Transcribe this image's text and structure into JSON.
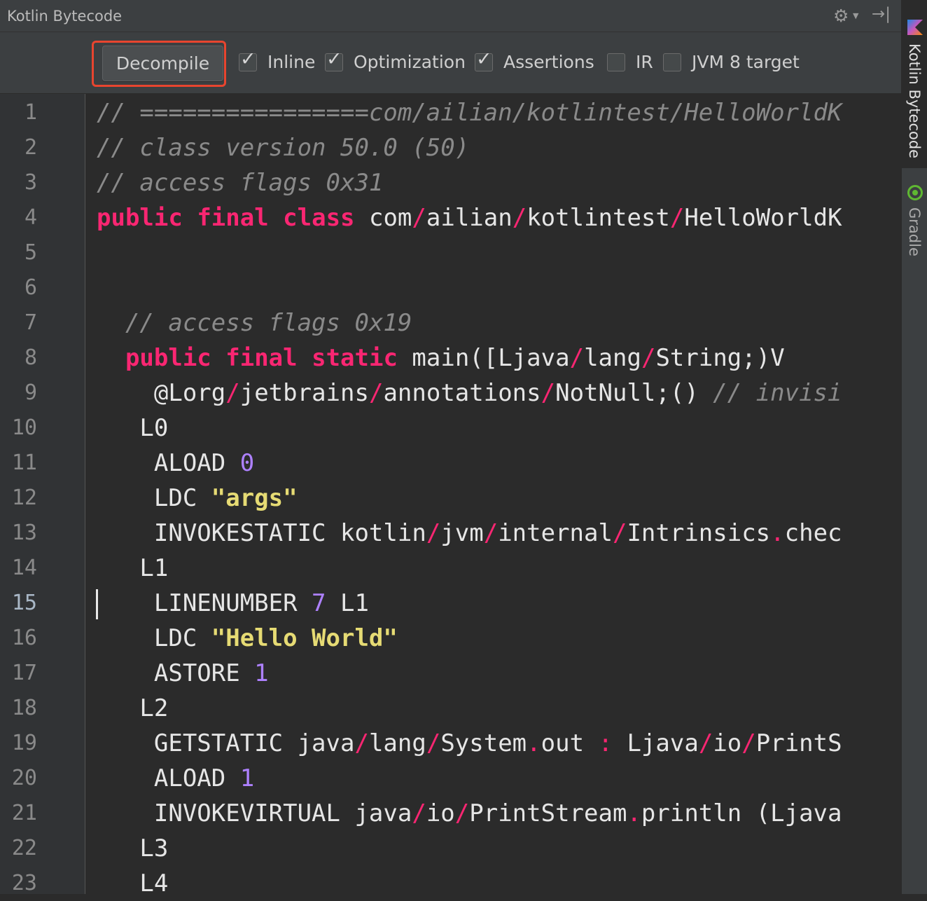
{
  "window": {
    "title": "Kotlin Bytecode",
    "gear_icon": "gear-icon",
    "hide_icon": "hide-panel-icon"
  },
  "toolbar": {
    "decompile_label": "Decompile",
    "checkboxes": [
      {
        "label": "Inline",
        "checked": true
      },
      {
        "label": "Optimization",
        "checked": true
      },
      {
        "label": "Assertions",
        "checked": true
      },
      {
        "label": "IR",
        "checked": false
      },
      {
        "label": "JVM 8 target",
        "checked": false
      }
    ],
    "highlight_color": "#e8452f"
  },
  "side_tabs": [
    {
      "label": "Kotlin Bytecode",
      "active": true
    },
    {
      "label": "Gradle",
      "active": false
    }
  ],
  "editor": {
    "current_line": 15,
    "line_numbers": [
      "1",
      "2",
      "3",
      "4",
      "5",
      "6",
      "7",
      "8",
      "9",
      "10",
      "11",
      "12",
      "13",
      "14",
      "15",
      "16",
      "17",
      "18",
      "19",
      "20",
      "21",
      "22",
      "23"
    ],
    "lines": [
      [
        {
          "t": "// ================com/ailian/kotlintest/HelloWorldK",
          "c": "c"
        }
      ],
      [
        {
          "t": "// class version 50.0 (50)",
          "c": "c"
        }
      ],
      [
        {
          "t": "// access flags 0x31",
          "c": "c"
        }
      ],
      [
        {
          "t": "public",
          "c": "k"
        },
        {
          "t": " ",
          "c": ""
        },
        {
          "t": "final",
          "c": "k"
        },
        {
          "t": " ",
          "c": ""
        },
        {
          "t": "class",
          "c": "k"
        },
        {
          "t": " com",
          "c": ""
        },
        {
          "t": "/",
          "c": "p"
        },
        {
          "t": "ailian",
          "c": ""
        },
        {
          "t": "/",
          "c": "p"
        },
        {
          "t": "kotlintest",
          "c": ""
        },
        {
          "t": "/",
          "c": "p"
        },
        {
          "t": "HelloWorldK",
          "c": ""
        }
      ],
      [],
      [],
      [
        {
          "t": "  ",
          "c": ""
        },
        {
          "t": "// access flags 0x19",
          "c": "c"
        }
      ],
      [
        {
          "t": "  ",
          "c": ""
        },
        {
          "t": "public",
          "c": "k"
        },
        {
          "t": " ",
          "c": ""
        },
        {
          "t": "final",
          "c": "k"
        },
        {
          "t": " ",
          "c": ""
        },
        {
          "t": "static",
          "c": "k"
        },
        {
          "t": " main([Ljava",
          "c": ""
        },
        {
          "t": "/",
          "c": "p"
        },
        {
          "t": "lang",
          "c": ""
        },
        {
          "t": "/",
          "c": "p"
        },
        {
          "t": "String;)V",
          "c": ""
        }
      ],
      [
        {
          "t": "    @Lorg",
          "c": ""
        },
        {
          "t": "/",
          "c": "p"
        },
        {
          "t": "jetbrains",
          "c": ""
        },
        {
          "t": "/",
          "c": "p"
        },
        {
          "t": "annotations",
          "c": ""
        },
        {
          "t": "/",
          "c": "p"
        },
        {
          "t": "NotNull;() ",
          "c": ""
        },
        {
          "t": "// invisi",
          "c": "c"
        }
      ],
      [
        {
          "t": "   L0",
          "c": ""
        }
      ],
      [
        {
          "t": "    ALOAD ",
          "c": ""
        },
        {
          "t": "0",
          "c": "n"
        }
      ],
      [
        {
          "t": "    LDC ",
          "c": ""
        },
        {
          "t": "\"args\"",
          "c": "s"
        }
      ],
      [
        {
          "t": "    INVOKESTATIC kotlin",
          "c": ""
        },
        {
          "t": "/",
          "c": "p"
        },
        {
          "t": "jvm",
          "c": ""
        },
        {
          "t": "/",
          "c": "p"
        },
        {
          "t": "internal",
          "c": ""
        },
        {
          "t": "/",
          "c": "p"
        },
        {
          "t": "Intrinsics",
          "c": ""
        },
        {
          "t": ".",
          "c": "p"
        },
        {
          "t": "chec",
          "c": ""
        }
      ],
      [
        {
          "t": "   L1",
          "c": ""
        }
      ],
      [
        {
          "t": "    LINENUMBER ",
          "c": ""
        },
        {
          "t": "7",
          "c": "n"
        },
        {
          "t": " L1",
          "c": ""
        }
      ],
      [
        {
          "t": "    LDC ",
          "c": ""
        },
        {
          "t": "\"Hello World\"",
          "c": "s"
        }
      ],
      [
        {
          "t": "    ASTORE ",
          "c": ""
        },
        {
          "t": "1",
          "c": "n"
        }
      ],
      [
        {
          "t": "   L2",
          "c": ""
        }
      ],
      [
        {
          "t": "    GETSTATIC java",
          "c": ""
        },
        {
          "t": "/",
          "c": "p"
        },
        {
          "t": "lang",
          "c": ""
        },
        {
          "t": "/",
          "c": "p"
        },
        {
          "t": "System",
          "c": ""
        },
        {
          "t": ".",
          "c": "p"
        },
        {
          "t": "out ",
          "c": ""
        },
        {
          "t": ":",
          "c": "p"
        },
        {
          "t": " Ljava",
          "c": ""
        },
        {
          "t": "/",
          "c": "p"
        },
        {
          "t": "io",
          "c": ""
        },
        {
          "t": "/",
          "c": "p"
        },
        {
          "t": "PrintS",
          "c": ""
        }
      ],
      [
        {
          "t": "    ALOAD ",
          "c": ""
        },
        {
          "t": "1",
          "c": "n"
        }
      ],
      [
        {
          "t": "    INVOKEVIRTUAL java",
          "c": ""
        },
        {
          "t": "/",
          "c": "p"
        },
        {
          "t": "io",
          "c": ""
        },
        {
          "t": "/",
          "c": "p"
        },
        {
          "t": "PrintStream",
          "c": ""
        },
        {
          "t": ".",
          "c": "p"
        },
        {
          "t": "println (Ljava",
          "c": ""
        }
      ],
      [
        {
          "t": "   L3",
          "c": ""
        }
      ],
      [
        {
          "t": "   L4",
          "c": ""
        }
      ]
    ]
  },
  "colors": {
    "keyword": "#f92672",
    "number": "#ae81ff",
    "string": "#e6db74",
    "comment": "#8a8a8a",
    "text": "#e6e6e6"
  }
}
